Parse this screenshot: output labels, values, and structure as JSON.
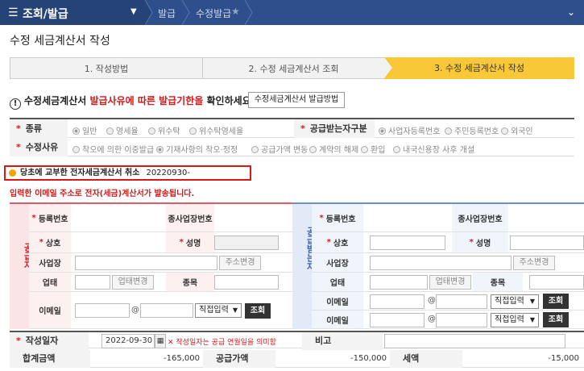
{
  "nav": {
    "menu_title": "조회/발급",
    "crumb1": "발급",
    "crumb2": "수정발급"
  },
  "page": {
    "title": "수정 세금계산서 작성"
  },
  "steps": [
    {
      "label": "1. 작성방법"
    },
    {
      "label": "2. 수정 세금계산서 조회"
    },
    {
      "label": "3. 수정 세금계산서 작성"
    }
  ],
  "notice": {
    "part1": "수정세금계산서",
    "part2": "발급사유에 따른 발급기한을",
    "part3": "확인하세요.",
    "button": "수정세금계산서 발급방법"
  },
  "type_row": {
    "label": "종류",
    "options": [
      "일반",
      "영세율",
      "위수탁",
      "위수탁영세율"
    ],
    "receiver_label": "공급받는자구분",
    "receiver_options": [
      "사업자등록번호",
      "주민등록번호",
      "외국인"
    ]
  },
  "reason_row": {
    "label": "수정사유",
    "options": [
      "착오에 의한 이중발급",
      "기재사항의 착오·정정",
      "공급가액 변동",
      "계약의 해제",
      "환입",
      "내국신용장 사후 개설"
    ]
  },
  "original": {
    "text": "당초에 교부한 전자세금계산서 취소",
    "number": "20220930-"
  },
  "warning": "입력한 이메일 주소로 전자(세금)계산서가 발송됩니다.",
  "supplier": {
    "vlabel": "공급자",
    "reg_no": "등록번호",
    "sub_reg": "종사업장번호",
    "company": "상호",
    "name": "성명",
    "address": "사업장",
    "addr_btn": "주소변경",
    "biz_type": "업태",
    "biz_btn": "업태변경",
    "item": "종목",
    "email": "이메일",
    "at": "@",
    "direct": "직접입력",
    "lookup": "조회"
  },
  "receiver": {
    "vlabel": "공급받는자",
    "reg_no": "등록번호",
    "sub_reg": "종사업장번호",
    "company": "상호",
    "name": "성명",
    "address": "사업장",
    "addr_btn": "주소변경",
    "biz_type": "업태",
    "biz_btn": "업태변경",
    "item": "종목",
    "email": "이메일",
    "at": "@",
    "direct": "직접입력",
    "lookup": "조회"
  },
  "bottom": {
    "date_label": "작성일자",
    "date_value": "2022-09-30",
    "date_note": "작성일자는 공급 연월일을 의미함",
    "remark_label": "비고",
    "total_label": "합계금액",
    "total_value": "-165,000",
    "supply_label": "공급가액",
    "supply_value": "-150,000",
    "tax_label": "세액",
    "tax_value": "-15,000"
  }
}
